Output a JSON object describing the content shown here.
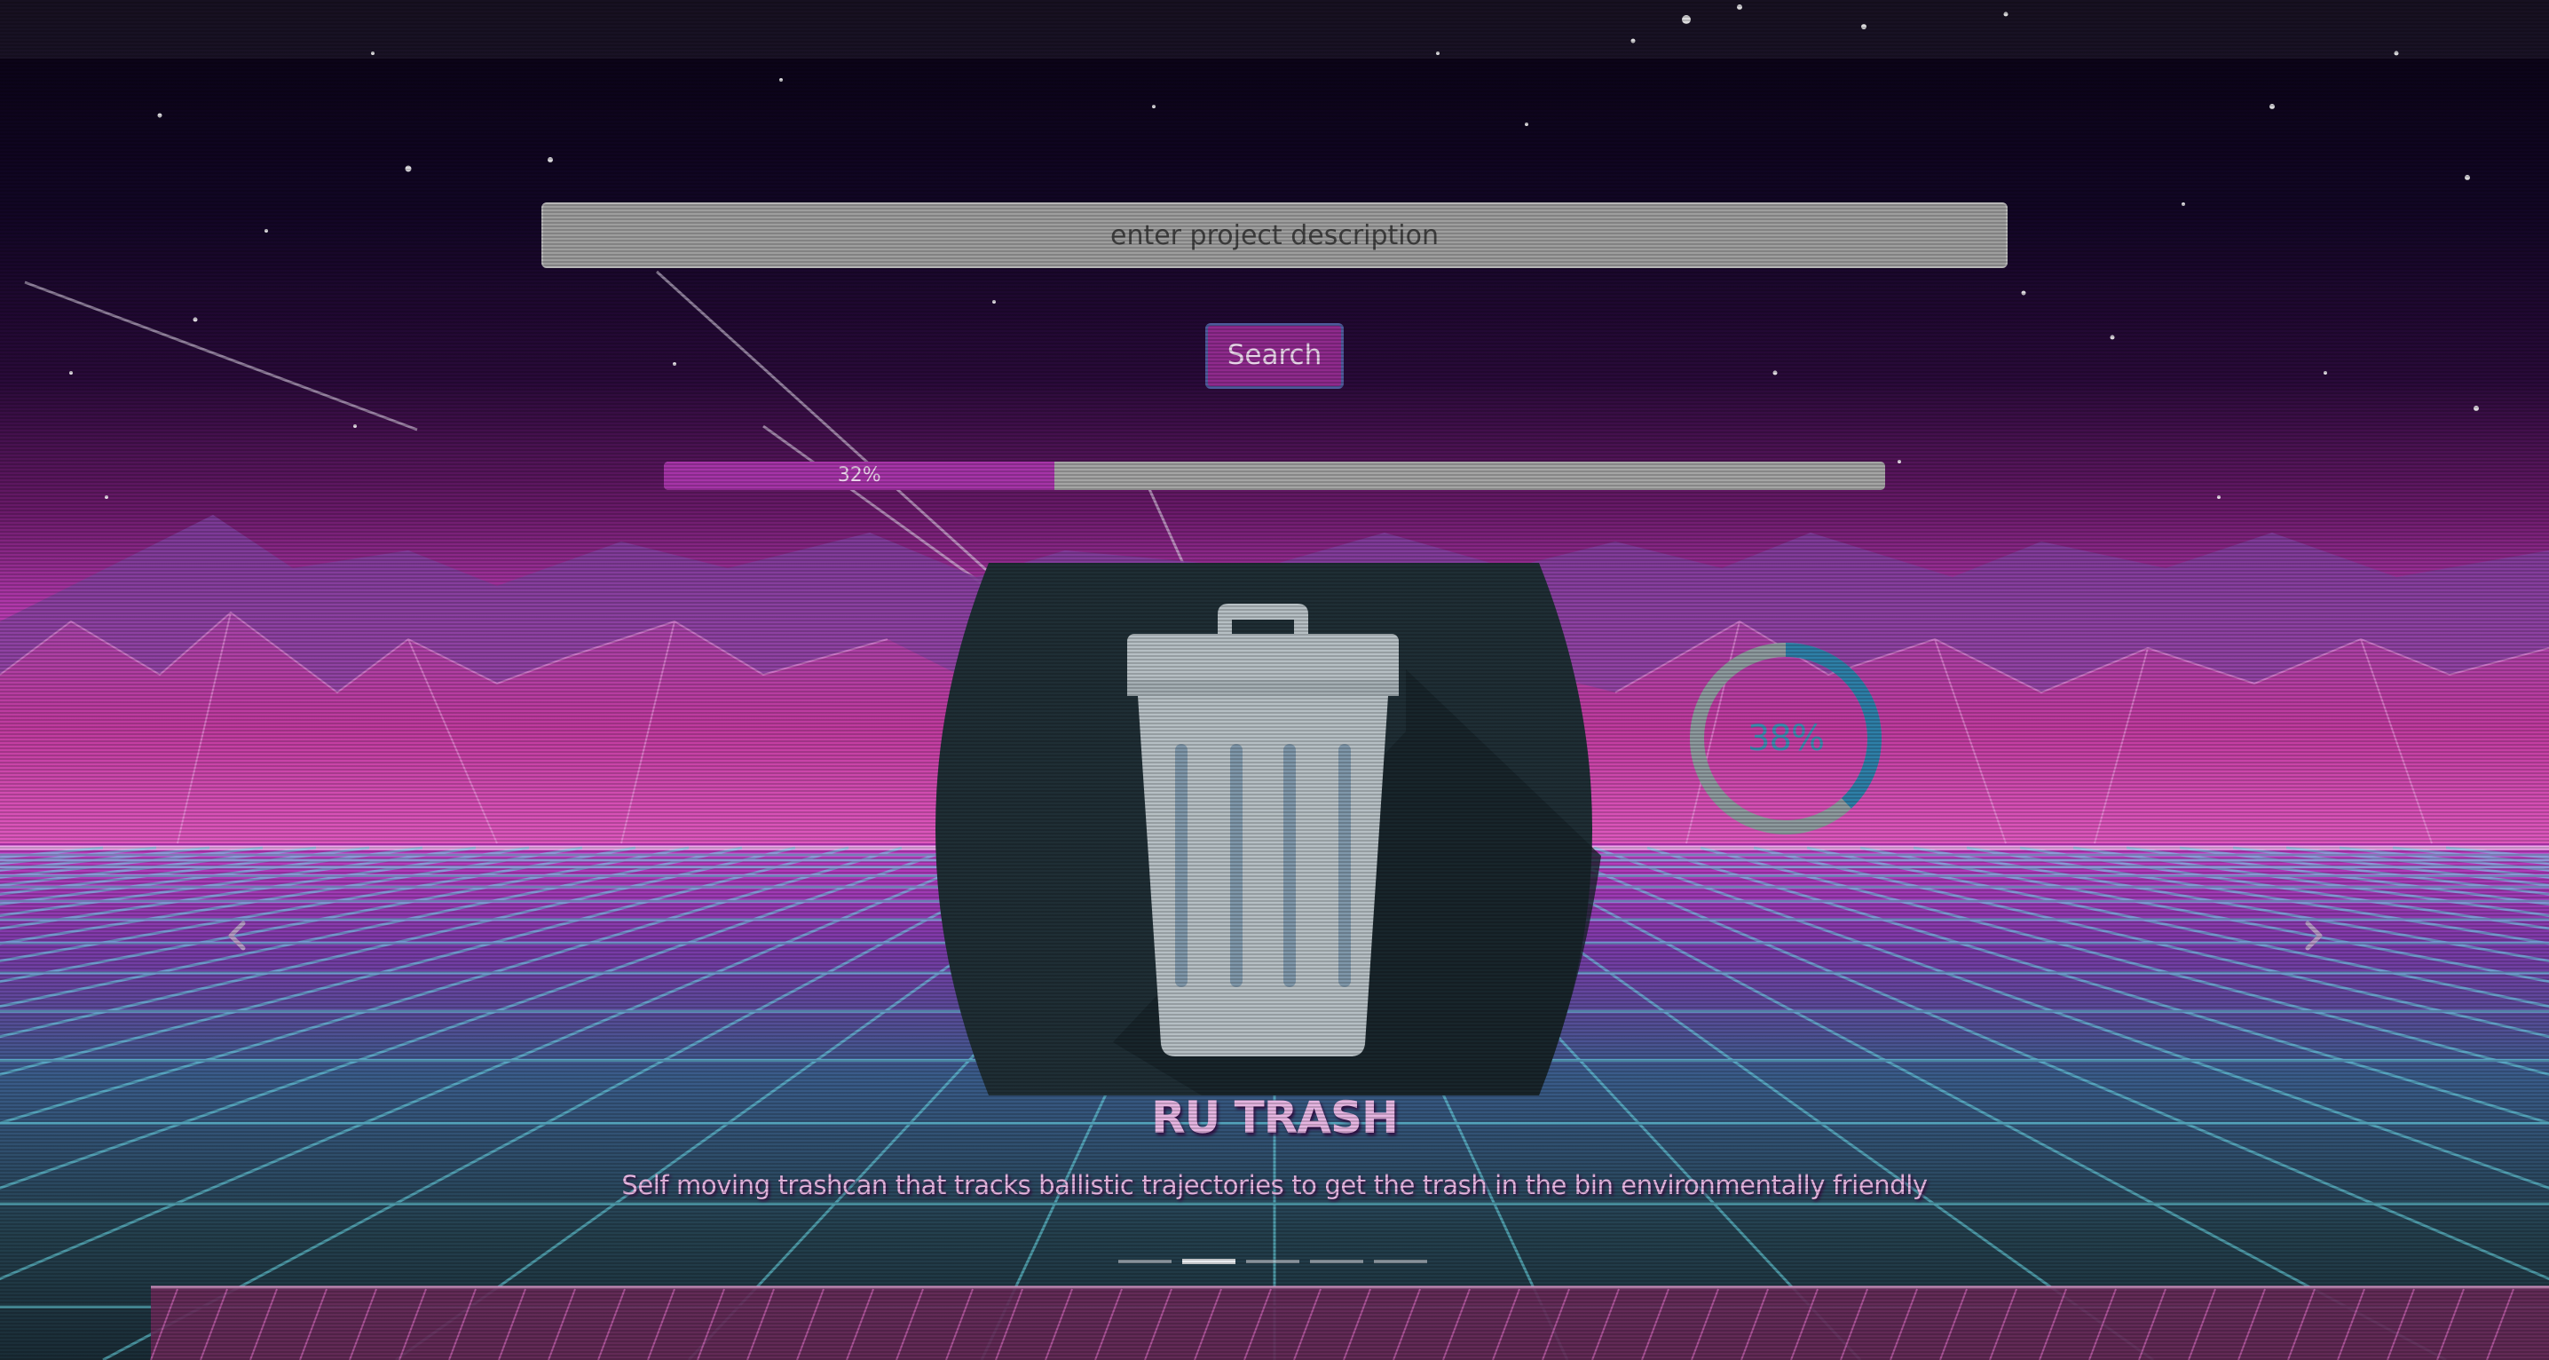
{
  "search": {
    "placeholder": "enter project description",
    "value": "",
    "button_label": "Search"
  },
  "progress": {
    "value_percent": 32,
    "label": "32%",
    "fill_color": "#a634a8",
    "track_color": "#a5a5a5"
  },
  "ring": {
    "value_percent": 38,
    "label": "38%",
    "arc_color": "#2e7fa8",
    "track_color": "#8e9a9e"
  },
  "carousel": {
    "previous_icon": "chevron-left-icon",
    "next_icon": "chevron-right-icon",
    "slide_count": 5,
    "active_index": 1,
    "slide": {
      "image_icon": "trash-can-icon",
      "title": "RU TRASH",
      "description": "Self moving trashcan that tracks ballistic trajectories to get the trash in the bin environmentally friendly"
    }
  },
  "theme": {
    "button_color": "#8f2a8d",
    "card_color": "#1f2e35",
    "title_color": "#e6b6e2"
  }
}
